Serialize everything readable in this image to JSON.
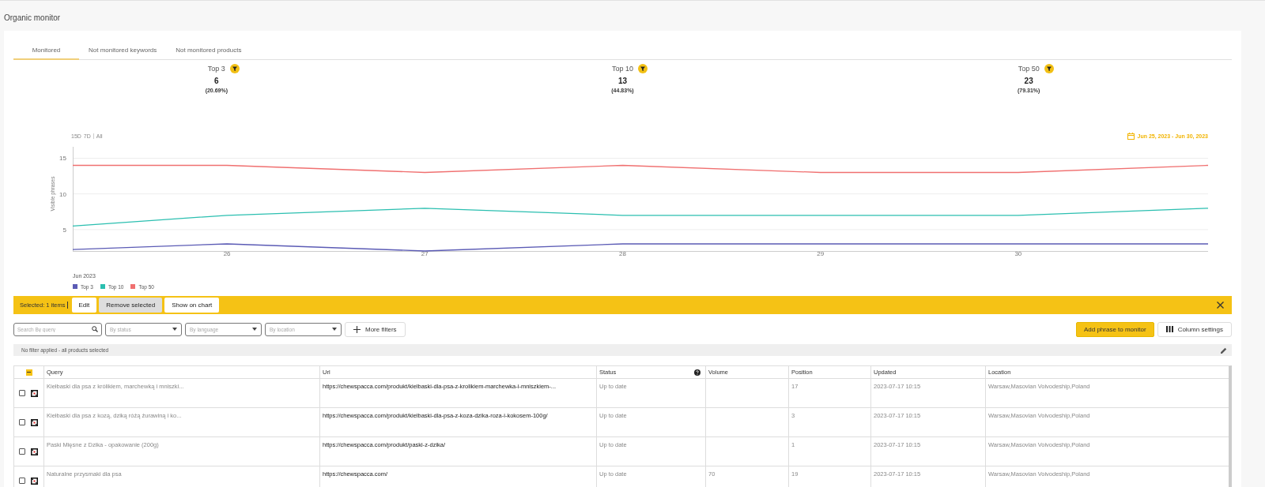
{
  "page_title": "Organic monitor",
  "tabs": [
    {
      "label": "Monitored",
      "selected": true
    },
    {
      "label": "Not monitored keywords",
      "selected": false
    },
    {
      "label": "Not monitored products",
      "selected": false
    }
  ],
  "stats": [
    {
      "label": "Top 3",
      "value": "6",
      "percent": "(20.69%)"
    },
    {
      "label": "Top 10",
      "value": "13",
      "percent": "(44.83%)"
    },
    {
      "label": "Top 50",
      "value": "23",
      "percent": "(79.31%)"
    }
  ],
  "chart": {
    "ranges": [
      {
        "label": "15D",
        "selected": false
      },
      {
        "label": "7D",
        "selected": false
      },
      {
        "label": "All",
        "selected": false
      }
    ],
    "date_range": "Jun 25, 2023 - Jun 30, 2023",
    "chart_data": {
      "type": "line",
      "xlabel": "Jun 2023",
      "ylabel": "Visible phrases",
      "x": [
        25.22,
        26,
        27,
        28,
        29,
        30,
        30.96
      ],
      "xlim": [
        25.22,
        30.96
      ],
      "ylim": [
        2,
        16.6
      ],
      "xticks": [
        26,
        27,
        28,
        29,
        30
      ],
      "yticks": [
        5,
        10,
        15
      ],
      "grid": true,
      "legend": true,
      "series": [
        {
          "name": "Top 3",
          "color": "#5b5bb5",
          "values": [
            2.2,
            3,
            2,
            3,
            3,
            3,
            3
          ]
        },
        {
          "name": "Top 10",
          "color": "#2bbfb0",
          "values": [
            5.5,
            7,
            8,
            7,
            7,
            7,
            8
          ]
        },
        {
          "name": "Top 50",
          "color": "#f07070",
          "values": [
            14,
            14,
            13,
            14,
            13,
            13,
            14
          ]
        }
      ]
    }
  },
  "selection_bar": {
    "text": "Selected: 1 items",
    "buttons": [
      {
        "label": "Edit",
        "selected": false
      },
      {
        "label": "Remove selected",
        "selected": true
      },
      {
        "label": "Show on chart",
        "selected": false
      }
    ]
  },
  "filters": {
    "search": {
      "placeholder": "Search By query"
    },
    "dropdowns": [
      {
        "placeholder": "By status"
      },
      {
        "placeholder": "By language"
      },
      {
        "placeholder": "By location"
      }
    ],
    "more": "More filters",
    "add": "Add phrase to monitor",
    "columns": "Column settings"
  },
  "filter_info": "No filter applied - all products selected",
  "table": {
    "select_all_indeterminate": true,
    "columns": [
      "Query",
      "Url",
      "Status",
      "Volume",
      "Position",
      "Updated",
      "Location"
    ],
    "rows": [
      {
        "checked": false,
        "cells": [
          "Kiełbaski dla psa z królikiem, marchewką i mniszki...",
          "https://chewspacca.com/produkt/kielbaski-dla-psa-z-krolikiem-marchewka-i-mniszkiem-...",
          "Up to date",
          "",
          "17",
          "2023-07-17 10:15",
          "Warsaw,Masovian Voivodeship,Poland"
        ]
      },
      {
        "checked": false,
        "cells": [
          "Kiełbaski dla psa z kozą, dziką różą żurawiną i ko...",
          "https://chewspacca.com/produkt/kielbaski-dla-psa-z-koza-dzika-roza-i-kokosem-100g/",
          "Up to date",
          "",
          "3",
          "2023-07-17 10:15",
          "Warsaw,Masovian Voivodeship,Poland"
        ]
      },
      {
        "checked": false,
        "cells": [
          "Paski Mięsne z Dzika - opakowanie (200g)",
          "https://chewspacca.com/produkt/paski-z-dzika/",
          "Up to date",
          "",
          "1",
          "2023-07-17 10:15",
          "Warsaw,Masovian Voivodeship,Poland"
        ]
      },
      {
        "checked": false,
        "cells": [
          "Naturalne przysmaki dla psa",
          "https://chewspacca.com/",
          "Up to date",
          "70",
          "19",
          "2023-07-17 10:15",
          "Warsaw,Masovian Voivodeship,Poland"
        ]
      }
    ]
  }
}
